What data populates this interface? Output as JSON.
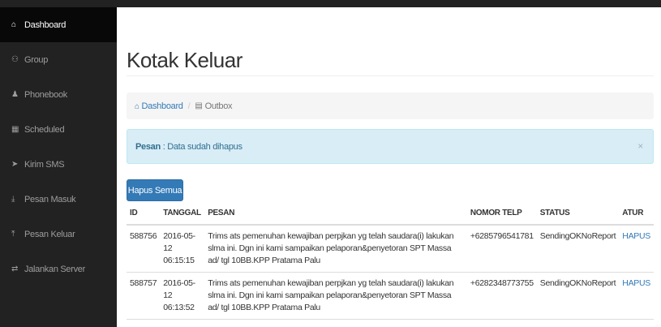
{
  "sidebar": {
    "items": [
      {
        "label": "Dashboard",
        "icon": "dashboard-icon",
        "glyph": "⌂",
        "active": true
      },
      {
        "label": "Group",
        "icon": "group-icon",
        "glyph": "⚇"
      },
      {
        "label": "Phonebook",
        "icon": "user-icon",
        "glyph": "♟"
      },
      {
        "label": "Scheduled",
        "icon": "calendar-icon",
        "glyph": "▦"
      },
      {
        "label": "Kirim SMS",
        "icon": "send-icon",
        "glyph": "➤"
      },
      {
        "label": "Pesan Masuk",
        "icon": "download-icon",
        "glyph": "⤓"
      },
      {
        "label": "Pesan Keluar",
        "icon": "upload-icon",
        "glyph": "⤒"
      },
      {
        "label": "Jalankan Server",
        "icon": "exchange-icon",
        "glyph": "⇄"
      }
    ]
  },
  "page": {
    "title": "Kotak Keluar"
  },
  "breadcrumb": {
    "home": "Dashboard",
    "separator": "/",
    "current": "Outbox"
  },
  "alert": {
    "label": "Pesan",
    "message": ": Data sudah dihapus",
    "close": "×"
  },
  "toolbar": {
    "delete_all": "Hapus Semua"
  },
  "table": {
    "headers": [
      "ID",
      "TANGGAL",
      "PESAN",
      "NOMOR TELP",
      "STATUS",
      "ATUR"
    ],
    "rows": [
      {
        "id": "588756",
        "date": "2016-05-12",
        "time": "06:15:15",
        "message": "Trims ats pemenuhan kewajiban perpjkan yg telah saudara(i) lakukan slma ini. Dgn ini kami sampaikan pelaporan&penyetoran SPT Massa ad/ tgl 10BB.KPP Pratama Palu",
        "phone": "+6285796541781",
        "status": "SendingOKNoReport",
        "action": "HAPUS"
      },
      {
        "id": "588757",
        "date": "2016-05-12",
        "time": "06:13:52",
        "message": "Trims ats pemenuhan kewajiban perpjkan yg telah saudara(i) lakukan slma ini. Dgn ini kami sampaikan pelaporan&penyetoran SPT Massa ad/ tgl 10BB.KPP Pratama Palu",
        "phone": "+6282348773755",
        "status": "SendingOKNoReport",
        "action": "HAPUS"
      }
    ]
  },
  "colors": {
    "sidebar_bg": "#222222",
    "sidebar_active": "#080808",
    "primary": "#337ab7",
    "alert_bg": "#d9edf7"
  }
}
